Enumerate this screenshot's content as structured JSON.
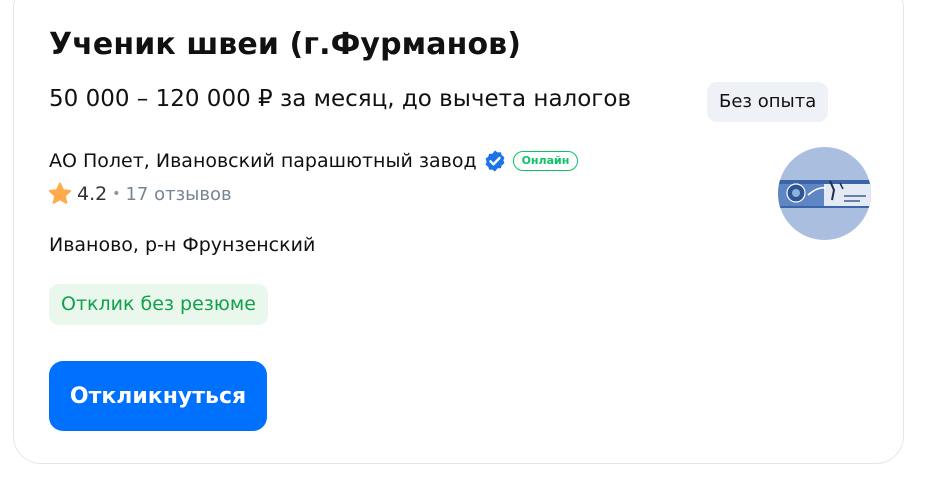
{
  "vacancy": {
    "title": "Ученик швеи (г.Фурманов)",
    "salary": "50 000 – 120 000 ₽ за месяц, до вычета налогов",
    "experience_badge": "Без опыта"
  },
  "company": {
    "name": "АО Полет, Ивановский парашютный завод",
    "verified_icon": "verified-check-icon",
    "online_badge": "Онлайн",
    "rating": "4.2",
    "rating_separator": "•",
    "reviews": "17 отзывов",
    "logo_icon": "company-logo"
  },
  "location": "Иваново, р-н Фрунзенский",
  "no_resume_badge": "Отклик без резюме",
  "respond_button": "Откликнуться",
  "colors": {
    "accent": "#0070ff",
    "success": "#0dc267",
    "star": "#ffaa4d",
    "verified": "#1a73e8"
  }
}
